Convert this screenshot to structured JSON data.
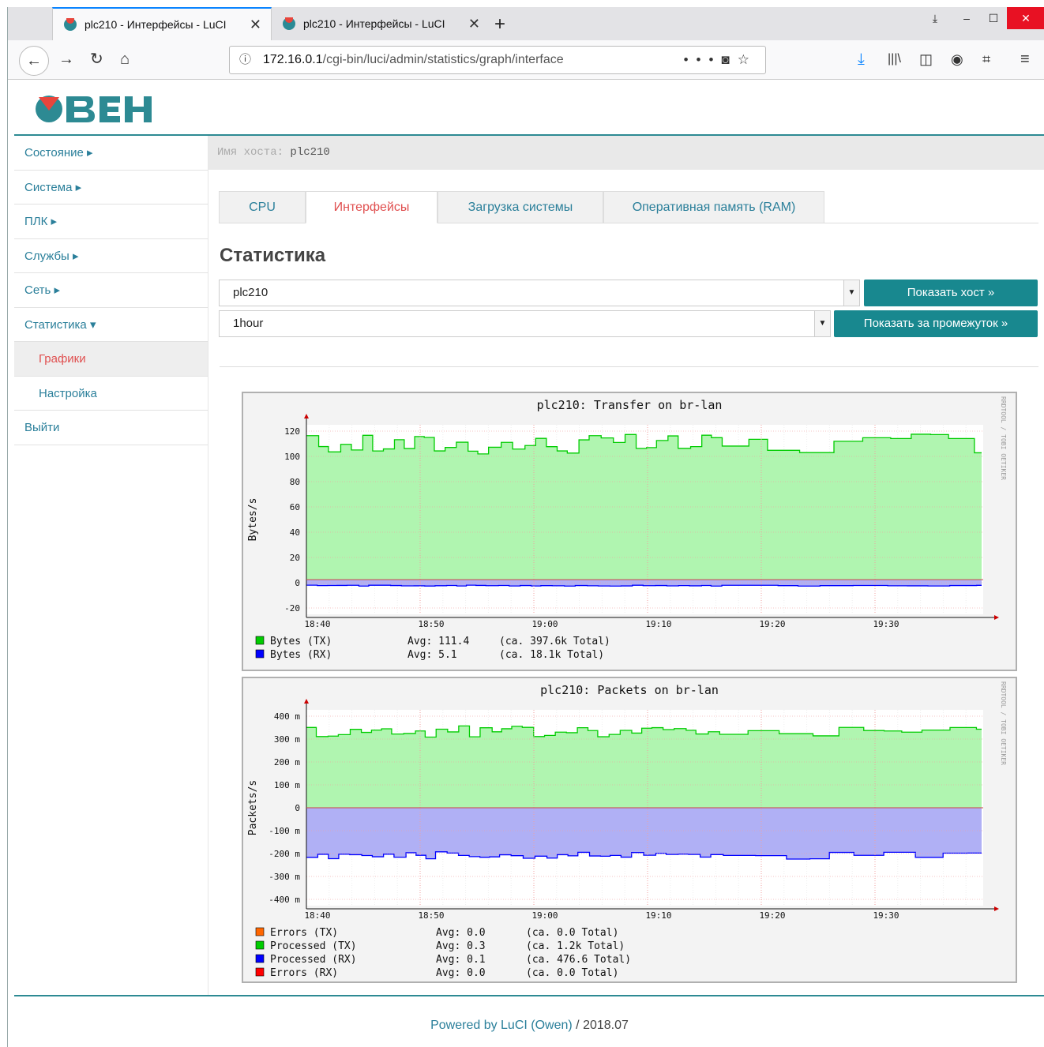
{
  "browser": {
    "tabs": [
      {
        "title": "plc210 - Интерфейсы - LuCI"
      },
      {
        "title": "plc210 - Интерфейсы - LuCI"
      }
    ],
    "url_host": "172.16.0.1",
    "url_path": "/cgi-bin/luci/admin/statistics/graph/interface",
    "url_dots": "•••"
  },
  "brand": {
    "accent": "#2d8a93",
    "logo_text": "ОВЕН"
  },
  "host_label": "Имя хоста:",
  "host_value": "plc210",
  "sidebar": {
    "items": [
      {
        "label": "Состояние ▸"
      },
      {
        "label": "Система ▸"
      },
      {
        "label": "ПЛК ▸"
      },
      {
        "label": "Службы ▸"
      },
      {
        "label": "Сеть ▸"
      },
      {
        "label": "Статистика ▾"
      },
      {
        "label": "Графики"
      },
      {
        "label": "Настройка"
      },
      {
        "label": "Выйти"
      }
    ]
  },
  "tabs": [
    {
      "label": "CPU"
    },
    {
      "label": "Интерфейсы"
    },
    {
      "label": "Загрузка системы"
    },
    {
      "label": "Оперативная память (RAM)"
    }
  ],
  "page_title": "Статистика",
  "host_select": {
    "value": "plc210"
  },
  "host_button": "Показать хост »",
  "span_select": {
    "value": "1hour"
  },
  "span_button": "Показать за промежуток »",
  "footer": {
    "link": "Powered by LuCI (Owen)",
    "version": " / 2018.07"
  },
  "chart_data": [
    {
      "type": "area",
      "title": "plc210: Transfer on br-lan",
      "ylabel": "Bytes/s",
      "side_label": "RRDTOOL / TOBI OETIKER",
      "yticks": [
        "120",
        "100",
        "80",
        "60",
        "40",
        "20",
        "0",
        "-20"
      ],
      "ylim": [
        -28,
        125
      ],
      "xticks": [
        "18:40",
        "18:50",
        "19:00",
        "19:10",
        "19:20",
        "19:30"
      ],
      "x_range": [
        "18:40",
        "19:39"
      ],
      "series": [
        {
          "name": "Bytes (TX)",
          "color": "#00cc00",
          "fill": "#b0f5b0",
          "approx_level": 112
        },
        {
          "name": "Bytes (RX)",
          "color": "#0000ff",
          "fill": "#b0b0f5",
          "approx_level": -5
        }
      ],
      "legend": [
        {
          "label": "Bytes (TX)",
          "avg": "Avg:  111.4",
          "total": "(ca. 397.6k Total)",
          "color": "#00cc00"
        },
        {
          "label": "Bytes (RX)",
          "avg": "Avg:    5.1",
          "total": "(ca.  18.1k Total)",
          "color": "#0000ff"
        }
      ]
    },
    {
      "type": "area",
      "title": "plc210: Packets on br-lan",
      "ylabel": "Packets/s",
      "side_label": "RRDTOOL / TOBI OETIKER",
      "yticks": [
        "400 m",
        "300 m",
        "200 m",
        "100 m",
        "0",
        "-100 m",
        "-200 m",
        "-300 m",
        "-400 m"
      ],
      "ylim": [
        -0.4,
        0.4
      ],
      "xticks": [
        "18:40",
        "18:50",
        "19:00",
        "19:10",
        "19:20",
        "19:30"
      ],
      "x_range": [
        "18:40",
        "19:39"
      ],
      "series": [
        {
          "name": "Processed (TX)",
          "color": "#00cc00",
          "fill": "#b0f5b0",
          "approx_level": 0.32
        },
        {
          "name": "Processed (RX)",
          "color": "#0000ff",
          "fill": "#b0b0f5",
          "approx_level": -0.2
        }
      ],
      "legend": [
        {
          "label": "Errors    (TX)",
          "avg": "Avg:   0.0",
          "total": "(ca.   0.0  Total)",
          "color": "#ff6600"
        },
        {
          "label": "Processed (TX)",
          "avg": "Avg:   0.3",
          "total": "(ca.   1.2k Total)",
          "color": "#00cc00"
        },
        {
          "label": "Processed (RX)",
          "avg": "Avg:   0.1",
          "total": "(ca. 476.6  Total)",
          "color": "#0000ff"
        },
        {
          "label": "Errors    (RX)",
          "avg": "Avg:   0.0",
          "total": "(ca.   0.0  Total)",
          "color": "#ff0000"
        }
      ]
    }
  ]
}
